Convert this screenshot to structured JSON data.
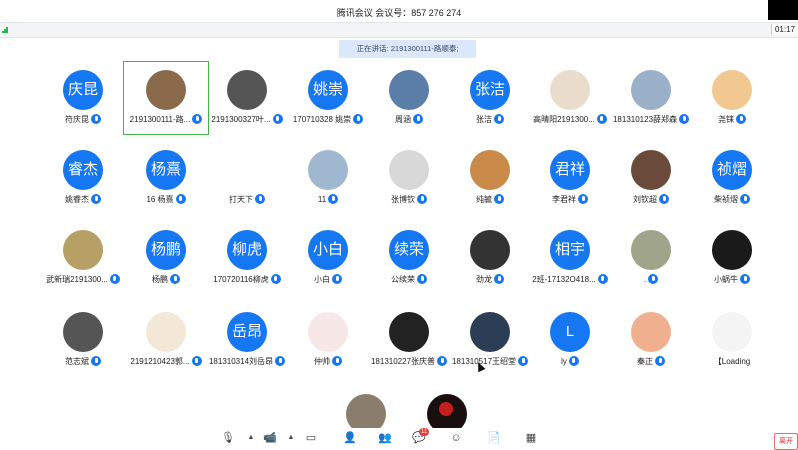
{
  "window": {
    "title": "腾讯会议 会议号：857 276 274",
    "clock": "01:17"
  },
  "speaking_banner": "正在讲话: 2191300111-路顺泰;",
  "participants": [
    {
      "label": "符庆昆",
      "initials": "庆昆"
    },
    {
      "label": "2191300111-路...",
      "photo_color": "#8a6a4a"
    },
    {
      "label": "2191300327叶...",
      "photo_color": "#555555"
    },
    {
      "label": "170710328 姚崇",
      "initials": "姚崇"
    },
    {
      "label": "周涵",
      "photo_color": "#5b7ea8"
    },
    {
      "label": "张洁",
      "initials": "张洁"
    },
    {
      "label": "高晴阳2191300...",
      "photo_color": "#e9dccd"
    },
    {
      "label": "181310123薛郑森",
      "photo_color": "#9ab0c8"
    },
    {
      "label": "尧铼",
      "photo_color": "#f0c890"
    },
    {
      "label": "姚睿杰",
      "initials": "睿杰"
    },
    {
      "label": "16 杨熹",
      "initials": "杨熹"
    },
    {
      "label": "打天下",
      "photo_color": "#ffffff"
    },
    {
      "label": "11",
      "photo_color": "#9fb7cf"
    },
    {
      "label": "张博钦",
      "photo_color": "#d8d8d8"
    },
    {
      "label": "纯毓",
      "photo_color": "#c98a4a"
    },
    {
      "label": "李君祥",
      "initials": "君祥"
    },
    {
      "label": "刘钦超",
      "photo_color": "#6a4a3a"
    },
    {
      "label": "柴祯熠",
      "initials": "祯熠"
    },
    {
      "label": "武新瑞2191300...",
      "photo_color": "#b7a066"
    },
    {
      "label": "杨鹏",
      "initials": "杨鹏"
    },
    {
      "label": "170720116柳虎",
      "initials": "柳虎"
    },
    {
      "label": "小白",
      "initials": "小白"
    },
    {
      "label": "公续荣",
      "initials": "续荣"
    },
    {
      "label": "劲龙",
      "photo_color": "#333333"
    },
    {
      "label": "2班-17132O418...",
      "initials": "相宇"
    },
    {
      "label": ".",
      "photo_color": "#a0a48a"
    },
    {
      "label": "小蜗牛",
      "photo_color": "#1a1a1a"
    },
    {
      "label": "范志斌",
      "photo_color": "#555555"
    },
    {
      "label": "2191210423郭...",
      "photo_color": "#f3e7d8"
    },
    {
      "label": "181310314刘岳昂",
      "initials": "岳昂"
    },
    {
      "label": "仲帅",
      "photo_color": "#f7e8e8"
    },
    {
      "label": "181310227张庆普",
      "photo_color": "#222222"
    },
    {
      "label": "181310517王绍堂",
      "photo_color": "#2c3e55"
    },
    {
      "label": "ly",
      "initials": "L"
    },
    {
      "label": "秦正",
      "photo_color": "#f0b090"
    },
    {
      "label": "【Loading",
      "photo_color": "#f4f4f4"
    }
  ],
  "toolbar": {
    "chat_badge": "11",
    "leave_label": "离开"
  },
  "colors": {
    "accent": "#1677f2",
    "selected_border": "#43b34a"
  }
}
